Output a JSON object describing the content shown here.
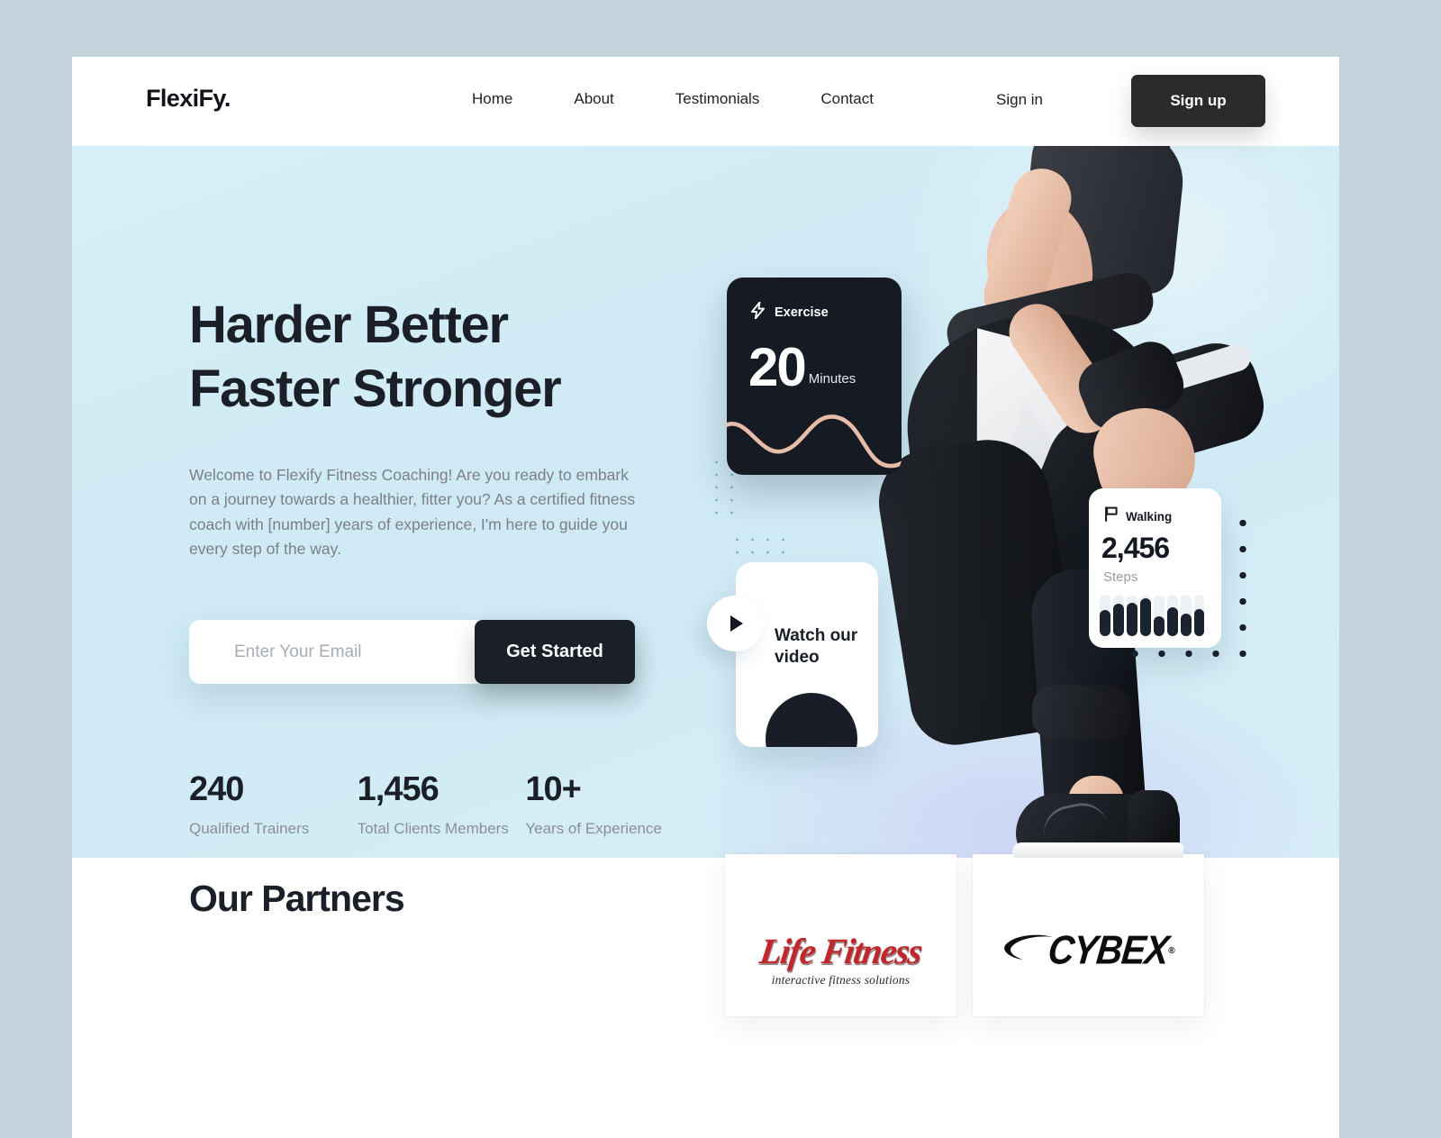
{
  "brand": {
    "logo": "FlexiFy."
  },
  "nav": {
    "items": [
      {
        "label": "Home"
      },
      {
        "label": "About"
      },
      {
        "label": "Testimonials"
      },
      {
        "label": "Contact"
      }
    ],
    "signin_label": "Sign in",
    "signup_label": "Sign up"
  },
  "hero": {
    "heading_line1": "Harder Better",
    "heading_line2": "Faster Stronger",
    "paragraph": "Welcome to Flexify Fitness Coaching! Are you ready to embark on a journey towards a healthier, fitter you? As a certified fitness coach with [number] years of experience, I'm here to guide you every step of the way.",
    "email_placeholder": "Enter Your Email",
    "email_value": "",
    "cta_label": "Get Started",
    "stats": [
      {
        "number": "240",
        "label": "Qualified Trainers"
      },
      {
        "number": "1,456",
        "label": "Total Clients Members"
      },
      {
        "number": "10+",
        "label": "Years of Experience"
      }
    ]
  },
  "cards": {
    "exercise": {
      "icon": "lightning-bolt-icon",
      "title": "Exercise",
      "value": "20",
      "unit": "Minutes"
    },
    "walking": {
      "icon": "flag-icon",
      "title": "Walking",
      "value": "2,456",
      "unit": "Steps",
      "bar_values": [
        62,
        78,
        80,
        92,
        48,
        70,
        55,
        66
      ]
    },
    "video": {
      "title": "Watch our video",
      "play_icon": "play-icon"
    }
  },
  "partners": {
    "title": "Our Partners",
    "logos": [
      {
        "name": "Life Fitness",
        "tagline": "interactive fitness solutions"
      },
      {
        "name": "CYBEX",
        "tagline": ""
      }
    ]
  },
  "colors": {
    "accent_dark": "#1b2028",
    "hero_bg": "#d2edf7",
    "page_bg": "#c4d2db",
    "wave": "#e8bda8",
    "lifefitness_red": "#c0272d"
  }
}
